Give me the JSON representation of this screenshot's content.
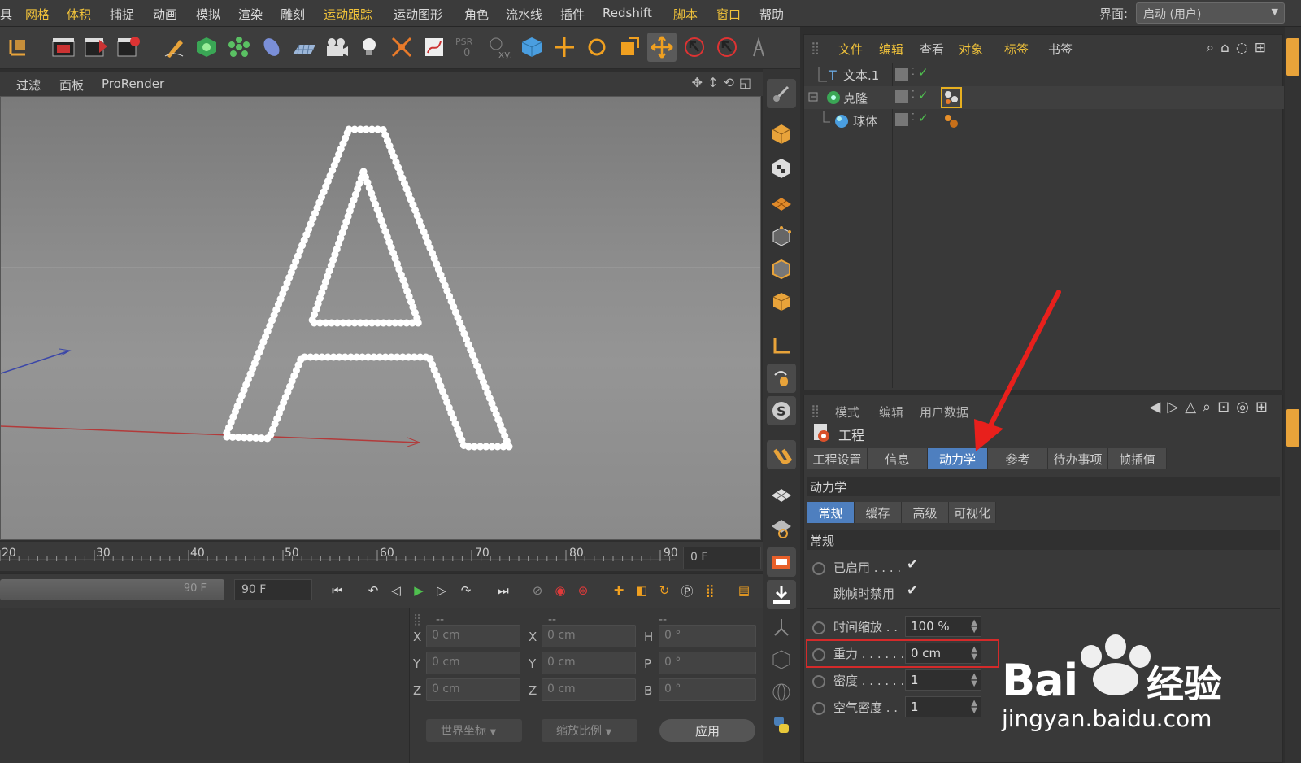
{
  "menubar": {
    "items": [
      {
        "label": "具",
        "hl": false
      },
      {
        "label": "网格",
        "hl": true
      },
      {
        "label": "体积",
        "hl": true
      },
      {
        "label": "捕捉",
        "hl": false
      },
      {
        "label": "动画",
        "hl": false
      },
      {
        "label": "模拟",
        "hl": false
      },
      {
        "label": "渲染",
        "hl": false
      },
      {
        "label": "雕刻",
        "hl": false
      },
      {
        "label": "运动跟踪",
        "hl": true
      },
      {
        "label": "运动图形",
        "hl": false
      },
      {
        "label": "角色",
        "hl": false
      },
      {
        "label": "流水线",
        "hl": false
      },
      {
        "label": "插件",
        "hl": false
      },
      {
        "label": "Redshift",
        "hl": false
      },
      {
        "label": "脚本",
        "hl": true
      },
      {
        "label": "窗口",
        "hl": true
      },
      {
        "label": "帮助",
        "hl": false
      }
    ],
    "layout_label": "界面:",
    "layout_value": "启动 (用户)"
  },
  "viewport_menu": {
    "items": [
      "过滤",
      "面板",
      "ProRender"
    ]
  },
  "viewport": {
    "text_object_letter": "A"
  },
  "timeline": {
    "ticks": [
      "20",
      "30",
      "40",
      "50",
      "60",
      "70",
      "80",
      "90"
    ],
    "current_frame": "0 F"
  },
  "transport": {
    "scrub_label": "90 F",
    "end_frame": "90 F"
  },
  "coords": {
    "headers": [
      "--",
      "--",
      "--"
    ],
    "rows": [
      {
        "l1": "X",
        "v1": "0 cm",
        "l2": "X",
        "v2": "0 cm",
        "l3": "H",
        "v3": "0 °"
      },
      {
        "l1": "Y",
        "v1": "0 cm",
        "l2": "Y",
        "v2": "0 cm",
        "l3": "P",
        "v3": "0 °"
      },
      {
        "l1": "Z",
        "v1": "0 cm",
        "l2": "Z",
        "v2": "0 cm",
        "l3": "B",
        "v3": "0 °"
      }
    ],
    "world_dropdown": "世界坐标",
    "scale_dropdown": "缩放比例",
    "apply": "应用"
  },
  "object_manager": {
    "menu": [
      {
        "label": "文件",
        "hl": true
      },
      {
        "label": "编辑",
        "hl": true
      },
      {
        "label": "查看",
        "hl": false
      },
      {
        "label": "对象",
        "hl": true
      },
      {
        "label": "标签",
        "hl": true
      },
      {
        "label": "书签",
        "hl": false
      }
    ],
    "objects": [
      {
        "name": "文本.1"
      },
      {
        "name": "克隆"
      },
      {
        "name": "球体"
      }
    ]
  },
  "attribute_manager": {
    "menu": [
      "模式",
      "编辑",
      "用户数据"
    ],
    "title": "工程",
    "tabs": [
      "工程设置",
      "信息",
      "动力学",
      "参考",
      "待办事项",
      "帧插值"
    ],
    "active_tab": "动力学",
    "section_title": "动力学",
    "subtabs": [
      "常规",
      "缓存",
      "高级",
      "可视化"
    ],
    "group_title": "常规",
    "enabled_label": "已启用 . . . .",
    "disable_on_skip_label": "跳帧时禁用",
    "time_scale": {
      "label": "时间缩放 . .",
      "value": "100 %"
    },
    "gravity": {
      "label": "重力 . . . . . .",
      "value": "0 cm"
    },
    "density": {
      "label": "密度 . . . . . .",
      "value": "1"
    },
    "air_density": {
      "label": "空气密度 . .",
      "value": "1"
    }
  },
  "watermark": {
    "brand": "Bai",
    "brand2": "经验",
    "url": "jingyan.baidu.com"
  },
  "colors": {
    "accent_tab": "#4e7fbf",
    "highlight_menu": "#f0c23a",
    "arrow": "#e8201c",
    "gravity_box": "#d42a2a"
  }
}
